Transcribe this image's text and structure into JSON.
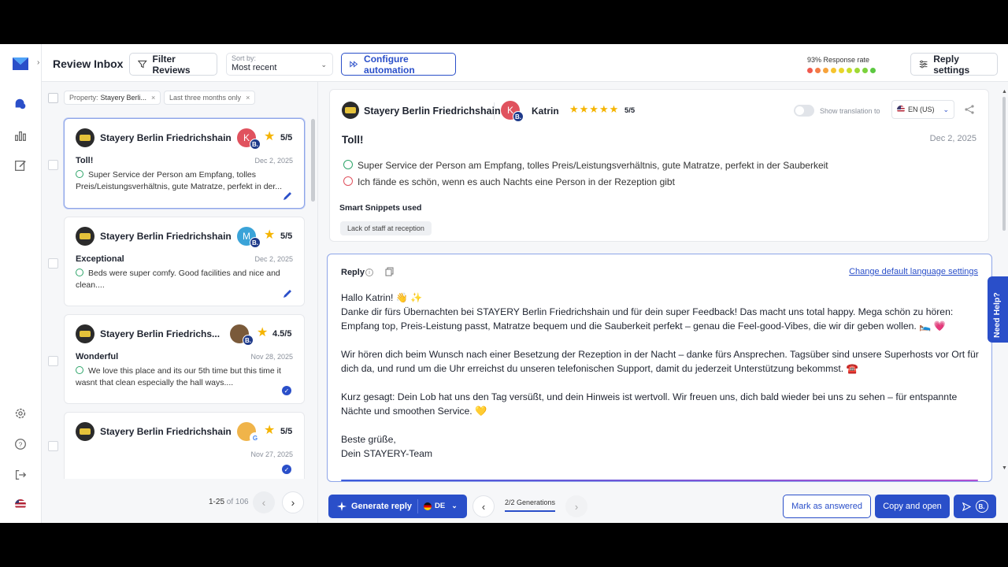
{
  "header": {
    "title": "Review Inbox",
    "filter_label": "Filter Reviews",
    "sort_label": "Sort by:",
    "sort_value": "Most recent",
    "automation_label": "Configure automation",
    "response_rate": "93% Response rate",
    "response_dot_colors": [
      "#f05a4f",
      "#f47b45",
      "#f7a33b",
      "#f6c42f",
      "#e9d52a",
      "#c9de2b",
      "#9fd934",
      "#7bd23c",
      "#5cc841"
    ],
    "reply_settings_label": "Reply settings"
  },
  "chips": {
    "property_key": "Property:",
    "property_value": "Stayery Berli...",
    "date_filter": "Last three months only",
    "remove": "×"
  },
  "reviews": [
    {
      "property": "Stayery Berlin Friedrichshain",
      "avatar_letter": "K",
      "avatar_color": "#e0525e",
      "source_badge": "B.",
      "score": "5/5",
      "title": "Toll!",
      "date": "Dec 2, 2025",
      "text": "Super Service der Person am Empfang, tolles Preis/Leistungsverhältnis, gute Matratze, perfekt in der..."
    },
    {
      "property": "Stayery Berlin Friedrichshain",
      "avatar_letter": "M",
      "avatar_color": "#3aa3d8",
      "source_badge": "B.",
      "score": "5/5",
      "title": "Exceptional",
      "date": "Dec 2, 2025",
      "text": "Beds were super comfy. Good facilities and nice and clean...."
    },
    {
      "property": "Stayery Berlin Friedrichs...",
      "avatar_letter": "",
      "avatar_color": "#7a5a3a",
      "source_badge": "B.",
      "score": "4.5/5",
      "title": "Wonderful",
      "date": "Nov 28, 2025",
      "text": "We love this place and its our 5th time but this time it wasnt that clean especially the hall ways...."
    },
    {
      "property": "Stayery Berlin Friedrichshain",
      "avatar_letter": "",
      "avatar_color": "#f0b44a",
      "source_badge": "G",
      "score": "5/5",
      "title": "",
      "date": "Nov 27, 2025",
      "text": ""
    }
  ],
  "pager": {
    "range": "1-25",
    "of_label": "of 106"
  },
  "detail": {
    "property": "Stayery Berlin Friedrichshain",
    "reviewer_letter": "K",
    "source_badge": "B.",
    "reviewer": "Katrin",
    "stars": "★★★★★",
    "score": "5/5",
    "translation_label": "Show translation to",
    "language": "EN (US)",
    "title": "Toll!",
    "date": "Dec 2, 2025",
    "positive": "Super Service der Person am Empfang, tolles Preis/Leistungsverhältnis, gute Matratze, perfekt in der Sauberkeit",
    "negative": "Ich fände es schön, wenn es auch Nachts eine Person in der Rezeption gibt",
    "snippets_title": "Smart Snippets used",
    "snippet": "Lack of staff at reception"
  },
  "reply": {
    "label": "Reply",
    "info": "i",
    "language_link": "Change default language settings",
    "p1_line1": "Hallo Katrin! 👋 ✨",
    "p1_line2": "Danke dir fürs Übernachten bei STAYERY Berlin Friedrichshain und für dein super Feedback! Das macht uns total happy. Mega schön zu hören: Empfang top, Preis-Leistung passt, Matratze bequem und die Sauberkeit perfekt – genau die Feel-good-Vibes, die wir dir geben wollen. 🛌 💗",
    "p2": "Wir hören dich beim Wunsch nach einer Besetzung der Rezeption in der Nacht – danke fürs Ansprechen. Tagsüber sind unsere Superhosts vor Ort für dich da, und rund um die Uhr erreichst du unseren telefonischen Support, damit du jederzeit Unterstützung bekommst. ☎️",
    "p3": "Kurz gesagt: Dein Lob hat uns den Tag versüßt, und dein Hinweis ist wertvoll. Wir freuen uns, dich bald wieder bei uns zu sehen – für entspannte Nächte und smoothen Service. 💛",
    "closing1": "Beste grüße,",
    "closing2": "Dein STAYERY-Team"
  },
  "need_help": "Need Help?",
  "actions": {
    "generate_label": "Generate reply",
    "generate_lang": "DE",
    "generations": "2/2 Generations",
    "mark_answered": "Mark as answered",
    "copy_open": "Copy and open",
    "send_badge": "B."
  },
  "colors": {
    "accent": "#2a4fc9",
    "star": "#f5b400"
  }
}
